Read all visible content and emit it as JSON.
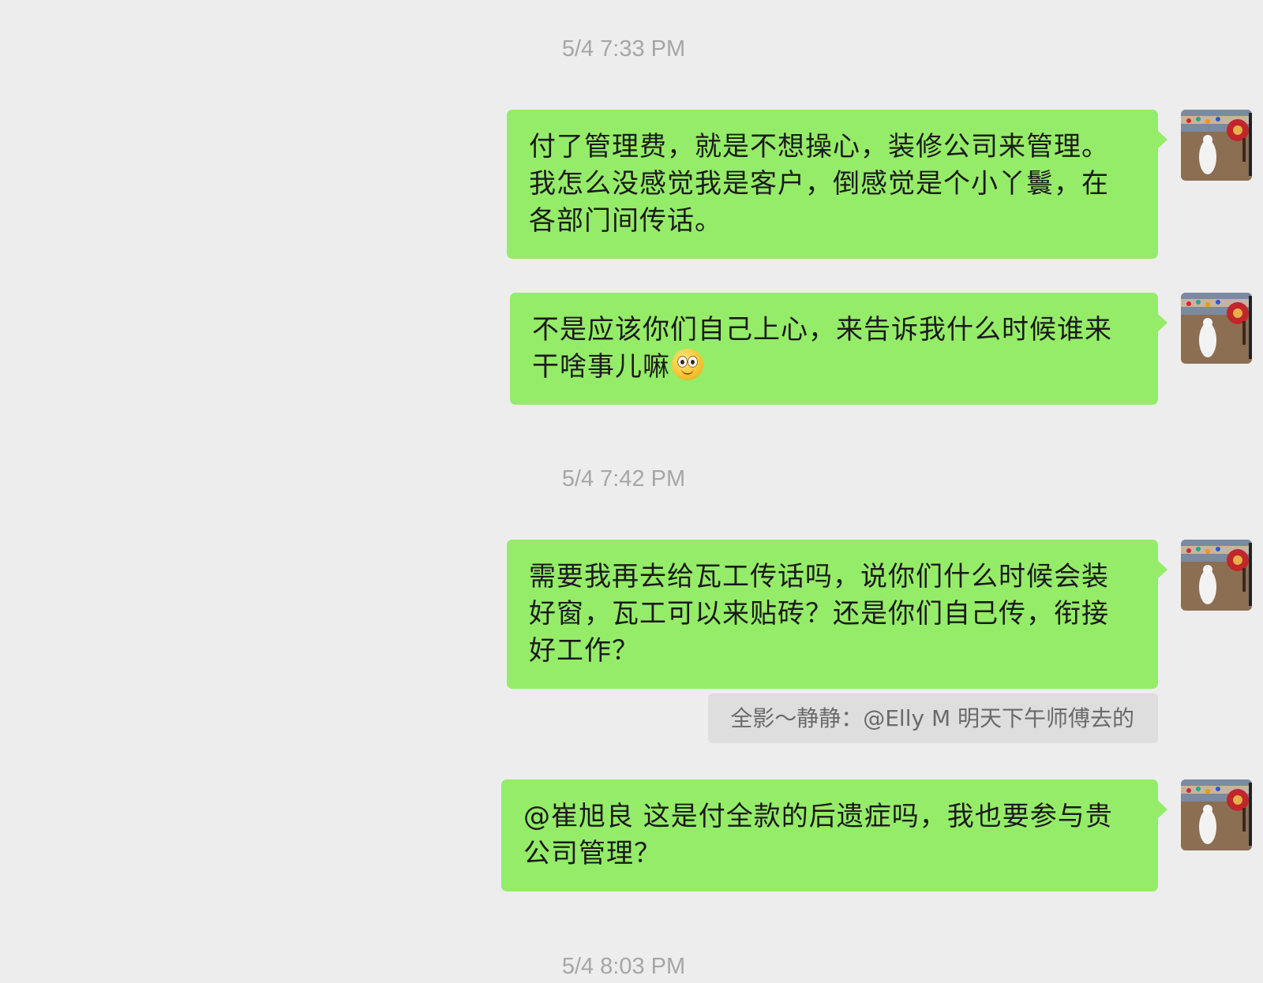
{
  "chat": {
    "timestamps": [
      "5/4 7:33 PM",
      "5/4 7:42 PM",
      "5/4 8:03 PM"
    ],
    "messages": [
      {
        "sender": "self",
        "text": "付了管理费，就是不想操心，装修公司来管理。我怎么没感觉我是客户，倒感觉是个小丫鬟，在各部门间传话。"
      },
      {
        "sender": "self",
        "text": "不是应该你们自己上心，来告诉我什么时候谁来干啥事儿嘛",
        "emoji": "smiling-face-emoji"
      },
      {
        "sender": "self",
        "text": "需要我再去给瓦工传话吗，说你们什么时候会装好窗，瓦工可以来贴砖？还是你们自己传，衔接好工作？",
        "quote": "全影～静静：@Elly M 明天下午师傅去的"
      },
      {
        "sender": "self",
        "text": "@崔旭良 这是付全款的后遗症吗，我也要参与贵公司管理？"
      }
    ]
  },
  "colors": {
    "background": "#ededed",
    "self_bubble": "#95ec69",
    "quote_bg": "#dedede",
    "timestamp": "#a6a6a6"
  }
}
